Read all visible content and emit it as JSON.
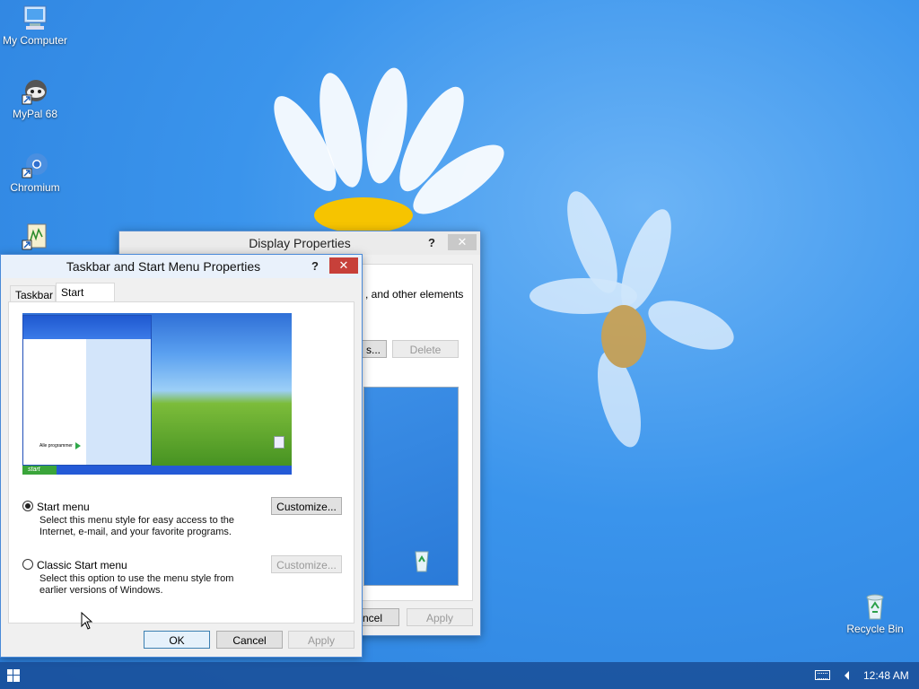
{
  "desktop": {
    "icons": [
      {
        "label": "My Computer",
        "icon": "computer-icon"
      },
      {
        "label": "MyPal 68",
        "icon": "mypal-icon"
      },
      {
        "label": "Chromium",
        "icon": "chromium-icon"
      },
      {
        "label": "",
        "icon": "app-shortcut-icon"
      },
      {
        "label": "Recycle Bin",
        "icon": "recycle-bin-icon"
      }
    ]
  },
  "display_properties": {
    "title": "Display Properties",
    "help": "?",
    "close": "✕",
    "visible_text": ", and other elements",
    "partial_button": "s...",
    "delete_button": "Delete",
    "cancel_button_partial": "ncel",
    "apply_button": "Apply"
  },
  "taskbar_props": {
    "title": "Taskbar and Start Menu Properties",
    "help": "?",
    "close": "✕",
    "tabs": [
      "Taskbar",
      "Start Menu"
    ],
    "active_tab": "Start Menu",
    "preview": {
      "start_label": "start",
      "all_programs": "Alle programmer"
    },
    "options": {
      "start_menu": {
        "label": "Start menu",
        "description": "Select this menu style for easy access to the Internet, e-mail, and your favorite programs.",
        "customize": "Customize...",
        "selected": true
      },
      "classic": {
        "label": "Classic Start menu",
        "description": "Select this option to use the menu style from earlier versions of Windows.",
        "customize": "Customize...",
        "selected": false
      }
    },
    "buttons": {
      "ok": "OK",
      "cancel": "Cancel",
      "apply": "Apply"
    }
  },
  "taskbar": {
    "clock": "12:48 AM"
  },
  "colors": {
    "accent": "#2b7fdc",
    "close_red": "#c7403a"
  }
}
